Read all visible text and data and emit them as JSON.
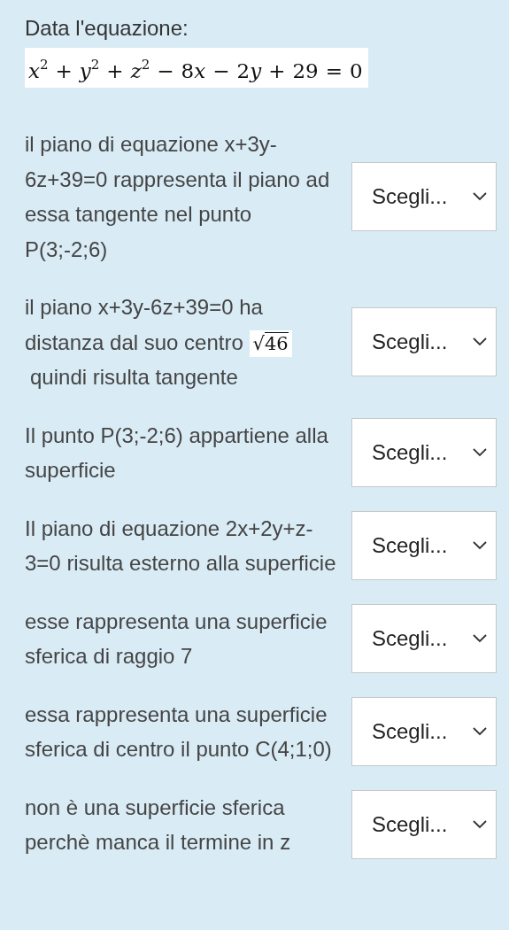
{
  "intro": "Data l'equazione:",
  "equation": [
    {
      "kind": "var",
      "text": "x"
    },
    {
      "kind": "sup",
      "text": "2"
    },
    {
      "kind": "op",
      "text": "+"
    },
    {
      "kind": "var",
      "text": "y"
    },
    {
      "kind": "sup",
      "text": "2"
    },
    {
      "kind": "op",
      "text": "+"
    },
    {
      "kind": "var",
      "text": "z"
    },
    {
      "kind": "sup",
      "text": "2"
    },
    {
      "kind": "op",
      "text": "−"
    },
    {
      "kind": "num",
      "text": "8"
    },
    {
      "kind": "var",
      "text": "x"
    },
    {
      "kind": "op",
      "text": "−"
    },
    {
      "kind": "num",
      "text": "2"
    },
    {
      "kind": "var",
      "text": "y"
    },
    {
      "kind": "op",
      "text": "+"
    },
    {
      "kind": "num",
      "text": "29"
    },
    {
      "kind": "op",
      "text": "="
    },
    {
      "kind": "num",
      "text": "0"
    }
  ],
  "items": [
    {
      "text": "il piano di equazione x+3y-6z+39=0 rappresenta il piano ad essa tangente nel punto P(3;-2;6)",
      "select": "Scegli..."
    },
    {
      "text": "il piano x+3y-6z+39=0 ha distanza dal suo centro",
      "math": {
        "radical": "√",
        "radicand": "46"
      },
      "text_after": "quindi risulta tangente",
      "select": "Scegli..."
    },
    {
      "text": "Il punto P(3;-2;6) appartiene alla superficie",
      "select": "Scegli..."
    },
    {
      "text": "Il piano di equazione 2x+2y+z-3=0 risulta esterno alla superficie",
      "select": "Scegli..."
    },
    {
      "text": "esse rappresenta una superficie sferica di raggio 7",
      "select": "Scegli..."
    },
    {
      "text": "essa rappresenta una superficie sferica di centro il punto C(4;1;0)",
      "select": "Scegli..."
    },
    {
      "text": "non è una superficie sferica perchè manca il termine in z",
      "select": "Scegli..."
    }
  ]
}
